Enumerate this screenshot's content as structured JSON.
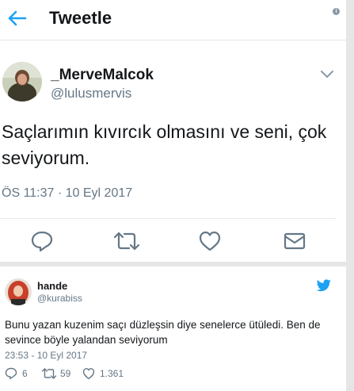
{
  "header": {
    "title": "Tweetle",
    "info_glyph": "i"
  },
  "main_tweet": {
    "display_name": "_MerveMalcok",
    "handle": "@lulusmervis",
    "text": "Saçlarımın kıvırcık olmasını ve seni, çok seviyorum.",
    "timestamp": "ÖS 11:37 · 10 Eyl 2017",
    "actions": [
      "reply-icon",
      "retweet-icon",
      "like-icon",
      "message-icon"
    ]
  },
  "reply_tweet": {
    "display_name": "hande",
    "handle": "@kurabiss",
    "text": "Bunu yazan kuzenim saçı düzleşsin diye senelerce ütüledi. Ben de sevince böyle yalandan seviyorum",
    "timestamp": "23:53 - 10 Eyl 2017",
    "stats": {
      "replies": "6",
      "retweets": "59",
      "likes": "1.361"
    }
  },
  "colors": {
    "accent": "#1da1f2",
    "muted": "#657786",
    "text": "#14171a",
    "background": "#e6e6e6"
  }
}
